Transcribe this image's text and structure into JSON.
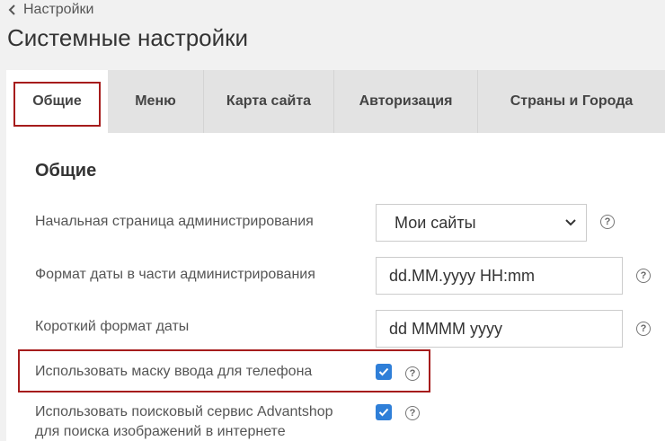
{
  "back_link": {
    "label": "Настройки"
  },
  "page_title": "Системные настройки",
  "tabs": [
    {
      "label": "Общие"
    },
    {
      "label": "Меню"
    },
    {
      "label": "Карта сайта"
    },
    {
      "label": "Авторизация"
    },
    {
      "label": "Страны и Города"
    }
  ],
  "section": {
    "title": "Общие",
    "rows": [
      {
        "label": "Начальная страница администрирования",
        "value": "Мои сайты"
      },
      {
        "label": "Формат даты в части администрирования",
        "value": "dd.MM.yyyy HH:mm"
      },
      {
        "label": "Короткий формат даты",
        "value": "dd MMMM yyyy"
      },
      {
        "label": "Использовать маску ввода для телефона",
        "checked": true
      },
      {
        "label_line1": "Использовать поисковый сервис Advantshop",
        "label_line2": "для поиска изображений в интернете",
        "checked": true
      }
    ]
  },
  "help_glyph": "?",
  "colors": {
    "accent": "#2f7fd8",
    "highlight": "#a61c1c"
  }
}
